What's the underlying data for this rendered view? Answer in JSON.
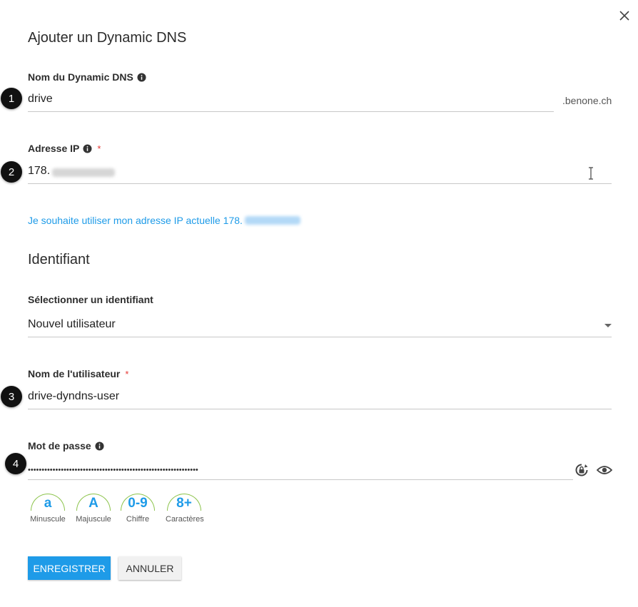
{
  "dialog": {
    "title": "Ajouter un Dynamic DNS",
    "close_icon": "close-icon"
  },
  "dyndns_name": {
    "label": "Nom du Dynamic DNS",
    "value": "drive",
    "suffix": ".benone.ch",
    "marker": "1"
  },
  "ip_address": {
    "label": "Adresse IP",
    "required_mark": "*",
    "value_prefix": "178.",
    "marker": "2"
  },
  "current_ip_link": {
    "text": "Je souhaite utiliser mon adresse IP actuelle 178."
  },
  "identifier_section": {
    "title": "Identifiant",
    "select_label": "Sélectionner un identifiant",
    "selected": "Nouvel utilisateur"
  },
  "username": {
    "label": "Nom de l'utilisateur",
    "required_mark": "*",
    "value": "drive-dyndns-user",
    "marker": "3"
  },
  "password": {
    "label": "Mot de passe",
    "masked_value": "••••••••••••••••••••••••••••••••••••••••••••••••••••••••••••••",
    "marker": "4",
    "generate_icon": "lock-refresh-icon",
    "reveal_icon": "eye-icon"
  },
  "strength": [
    {
      "symbol": "a",
      "caption": "Minuscule"
    },
    {
      "symbol": "A",
      "caption": "Majuscule"
    },
    {
      "symbol": "0-9",
      "caption": "Chiffre"
    },
    {
      "symbol": "8+",
      "caption": "Caractères"
    }
  ],
  "actions": {
    "save": "ENREGISTRER",
    "cancel": "ANNULER"
  },
  "colors": {
    "accent": "#1e9be8",
    "strength_ok": "#8bc34a",
    "required": "#e53935"
  }
}
